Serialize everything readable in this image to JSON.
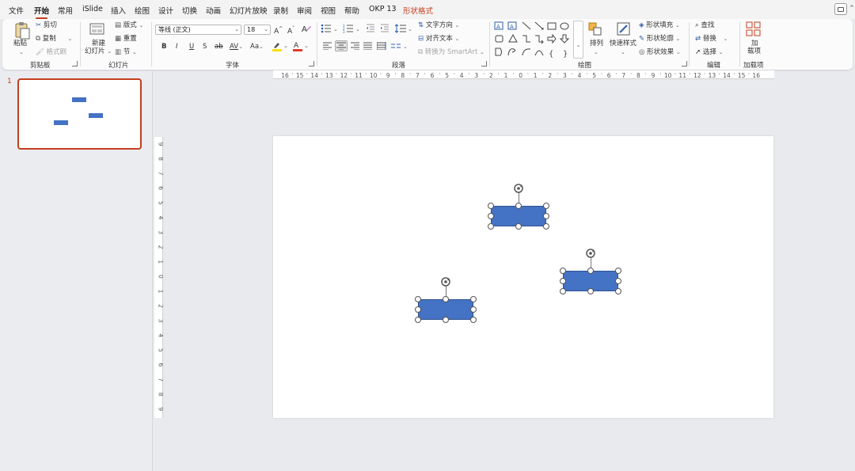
{
  "tabs": [
    "文件",
    "开始",
    "常用",
    "iSlide",
    "插入",
    "绘图",
    "设计",
    "切换",
    "动画",
    "幻灯片放映",
    "录制",
    "审阅",
    "视图",
    "帮助",
    "OKP 13",
    "形状格式"
  ],
  "active_tab": "开始",
  "ribbon": {
    "clipboard": {
      "paste": "粘贴",
      "cut": "剪切",
      "copy": "复制",
      "format_painter": "格式刷",
      "group_label": "剪贴板"
    },
    "slides": {
      "new_slide_line1": "新建",
      "new_slide_line2": "幻灯片",
      "layout": "版式",
      "reset": "重置",
      "section": "节",
      "group_label": "幻灯片"
    },
    "font": {
      "font_name": "等线 (正文)",
      "font_size": "18",
      "bold": "B",
      "italic": "I",
      "underline": "U",
      "shadow": "S",
      "strike": "ab",
      "spacing": "AV",
      "case": "Aa",
      "group_label": "字体"
    },
    "paragraph": {
      "text_direction": "文字方向",
      "align_text": "对齐文本",
      "smartart": "转换为 SmartArt",
      "group_label": "段落"
    },
    "drawing": {
      "arrange": "排列",
      "quick_styles": "快速样式",
      "shape_fill": "形状填充",
      "shape_outline": "形状轮廓",
      "shape_effects": "形状效果",
      "group_label": "绘图"
    },
    "editing": {
      "find": "查找",
      "replace": "替换",
      "select": "选择",
      "group_label": "编辑"
    },
    "addins": {
      "line1": "加",
      "line2": "载项",
      "group_label": "加载项"
    }
  },
  "thumbnail": {
    "slide_number": "1"
  },
  "ruler": {
    "horizontal": [
      "16",
      "15",
      "14",
      "13",
      "12",
      "11",
      "10",
      "9",
      "8",
      "7",
      "6",
      "5",
      "4",
      "3",
      "2",
      "1",
      "0",
      "1",
      "2",
      "3",
      "4",
      "5",
      "6",
      "7",
      "8",
      "9",
      "10",
      "11",
      "12",
      "13",
      "14",
      "15",
      "16"
    ],
    "vertical": [
      "9",
      "8",
      "7",
      "6",
      "5",
      "4",
      "3",
      "2",
      "1",
      "0",
      "1",
      "2",
      "3",
      "4",
      "5",
      "6",
      "7",
      "8",
      "9"
    ]
  },
  "colors": {
    "accent": "#c43e1c",
    "shape_fill": "#4472c4",
    "shape_border": "#2f528f",
    "font_color_bar": "#e03b2b",
    "highlight_bar": "#f5e100"
  }
}
